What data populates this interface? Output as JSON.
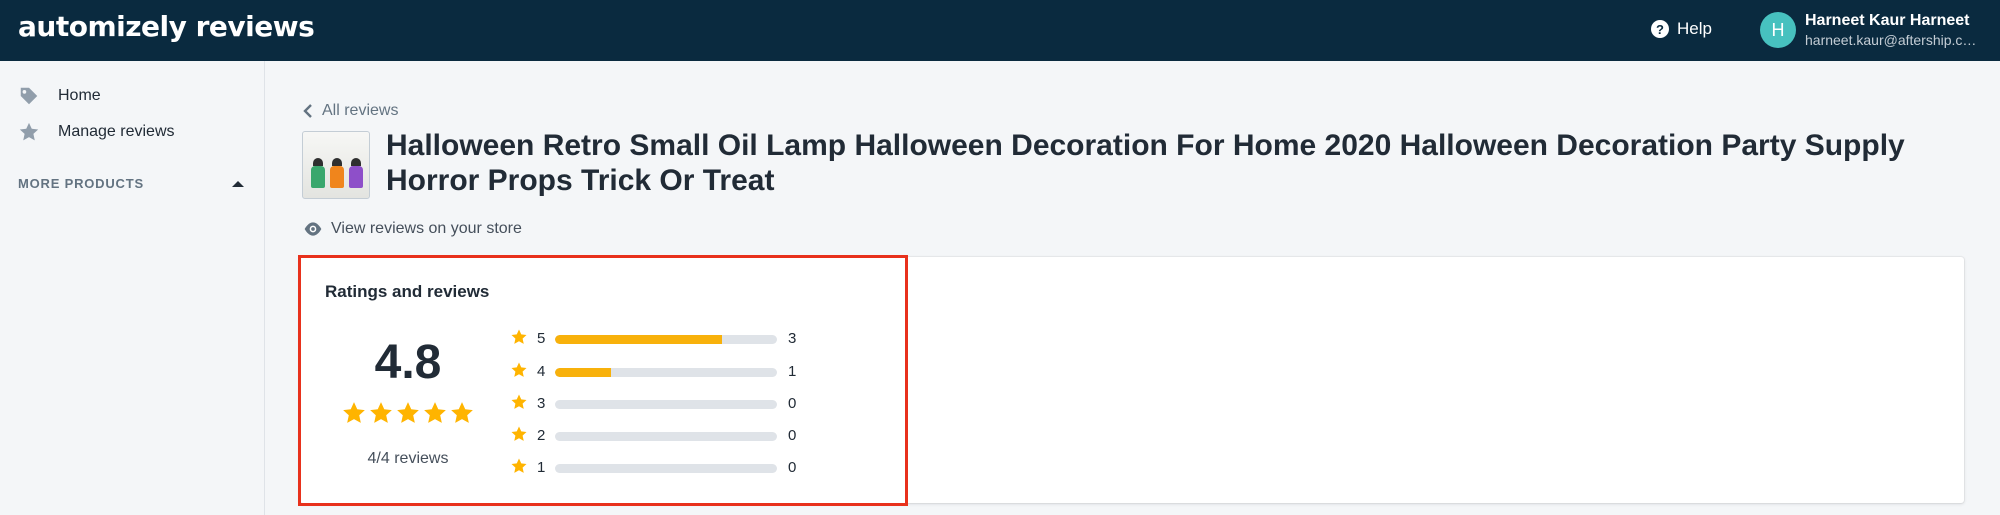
{
  "app": {
    "logo_text": "automizely reviews"
  },
  "header": {
    "help_label": "Help",
    "help_icon": "question-circle-icon",
    "user": {
      "initial": "H",
      "name": "Harneet Kaur Harneet",
      "email": "harneet.kaur@aftership.com",
      "avatar_color": "#47c1bf"
    }
  },
  "sidebar": {
    "items": [
      {
        "label": "Home",
        "icon": "tag-icon"
      },
      {
        "label": "Manage reviews",
        "icon": "star-icon"
      }
    ],
    "section_label": "MORE PRODUCTS"
  },
  "main": {
    "back_label": "All reviews",
    "product_title": "Halloween Retro Small Oil Lamp Halloween Decoration For Home 2020 Halloween Decoration Party Supply Horror Props Trick Or Treat",
    "view_store_label": "View reviews on your store",
    "card": {
      "title": "Ratings and reviews",
      "average_rating": "4.8",
      "reviews_summary": "4/4 reviews",
      "distribution": [
        {
          "stars": "5",
          "count": "3",
          "fraction": 0.75
        },
        {
          "stars": "4",
          "count": "1",
          "fraction": 0.25
        },
        {
          "stars": "3",
          "count": "0",
          "fraction": 0
        },
        {
          "stars": "2",
          "count": "0",
          "fraction": 0
        },
        {
          "stars": "1",
          "count": "0",
          "fraction": 0
        }
      ]
    }
  },
  "colors": {
    "topbar": "#0a2a3f",
    "star": "#ffb400",
    "bar_fill": "#f8b10b",
    "highlight_border": "#e8311c"
  }
}
